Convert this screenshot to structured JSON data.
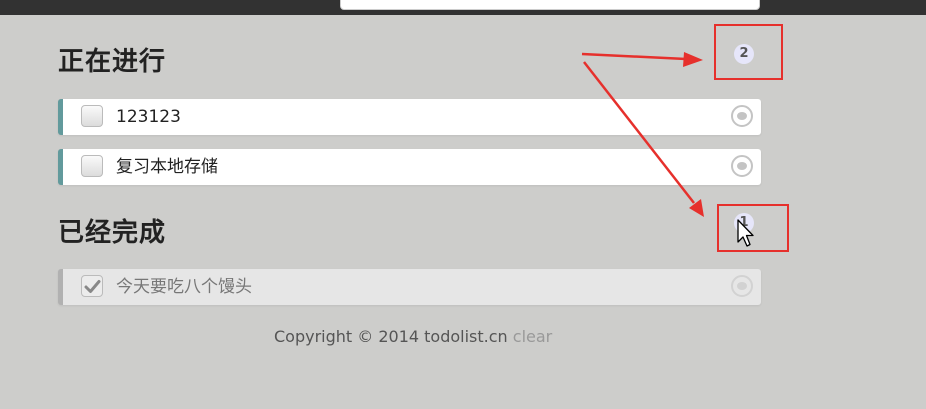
{
  "doing": {
    "title": "正在进行",
    "count": "2",
    "items": [
      {
        "text": "123123"
      },
      {
        "text": "复习本地存储"
      }
    ]
  },
  "done": {
    "title": "已经完成",
    "count": "1",
    "items": [
      {
        "text": "今天要吃八个馒头"
      }
    ]
  },
  "footer": {
    "copyright": "Copyright © 2014 todolist.cn",
    "clear_label": "clear"
  },
  "colors": {
    "background": "#cdcdcb",
    "active_stripe": "#629a9c",
    "done_stripe": "#b1b1b1",
    "annotation_red": "#e6302c",
    "count_badge": "#e6e6fa"
  },
  "icons": {
    "delete": "delete-circle-icon",
    "check": "checkmark-icon",
    "pointer": "mouse-cursor-icon"
  }
}
